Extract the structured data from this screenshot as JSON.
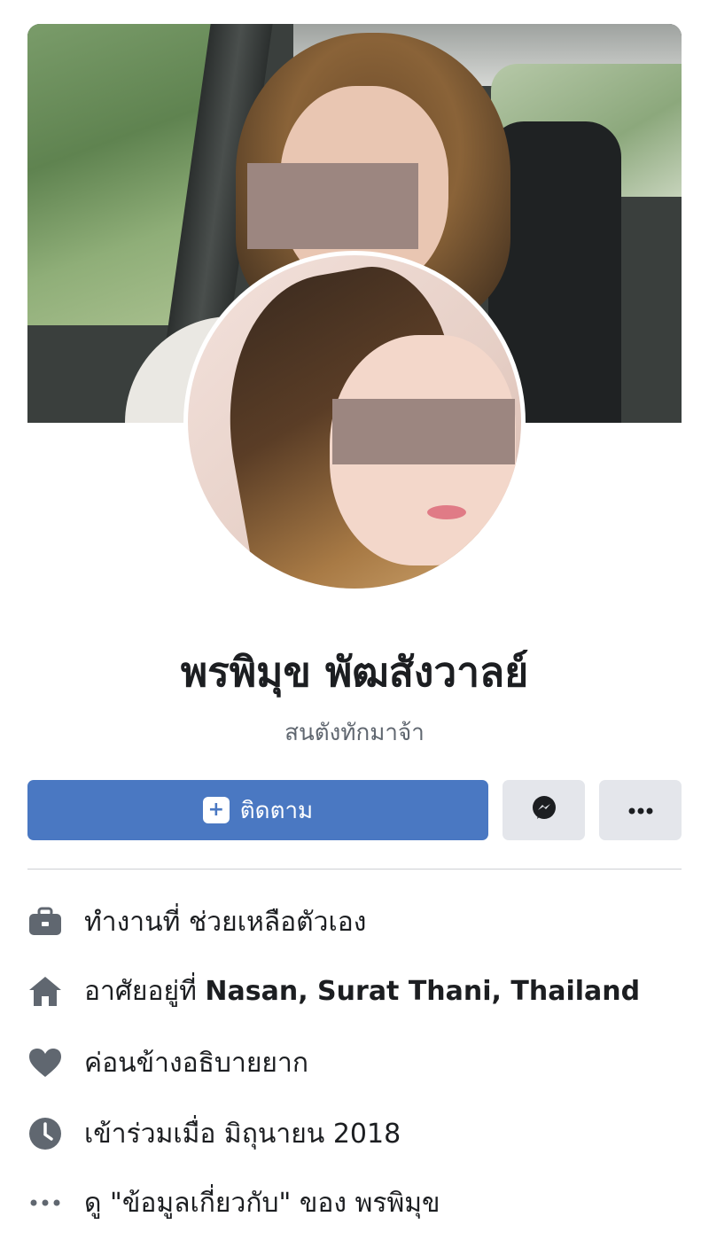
{
  "profile": {
    "name": "พรพิมุข พัฒสังวาลย์",
    "bio": "สนตังทักมาจ้า"
  },
  "actions": {
    "follow_label": "ติดตาม",
    "follow_icon": "add-follow-icon",
    "messenger_icon": "messenger-icon",
    "more_icon": "more-icon"
  },
  "colors": {
    "primary_button": "#4a78c2",
    "secondary_button": "#e4e6eb",
    "icon_gray": "#606770"
  },
  "details": [
    {
      "icon": "briefcase-icon",
      "prefix": "ทำงานที่ ช่วยเหลือตัวเอง",
      "bold": ""
    },
    {
      "icon": "home-icon",
      "prefix": "อาศัยอยู่ที่ ",
      "bold": "Nasan, Surat Thani, Thailand"
    },
    {
      "icon": "heart-icon",
      "prefix": "ค่อนข้างอธิบายยาก",
      "bold": ""
    },
    {
      "icon": "clock-icon",
      "prefix": "เข้าร่วมเมื่อ มิถุนายน  2018",
      "bold": ""
    },
    {
      "icon": "ellipsis-icon",
      "prefix": "ดู \"ข้อมูลเกี่ยวกับ\" ของ พรพิมุข",
      "bold": ""
    }
  ]
}
